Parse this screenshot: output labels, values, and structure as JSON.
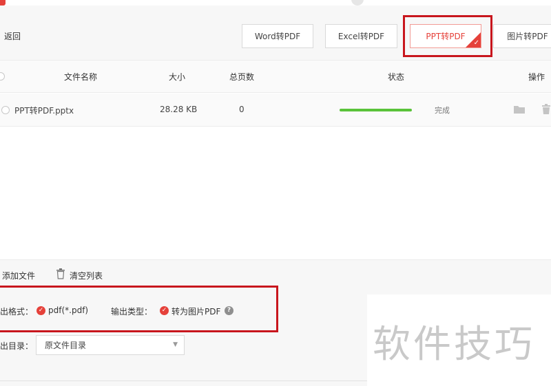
{
  "toolbar": {
    "back_label": "返回",
    "tabs": [
      {
        "label": "Word转PDF"
      },
      {
        "label": "Excel转PDF"
      },
      {
        "label": "PPT转PDF",
        "selected": true
      },
      {
        "label": "图片转PDF"
      }
    ]
  },
  "table": {
    "headers": {
      "filename": "文件名称",
      "size": "大小",
      "pages": "总页数",
      "status": "状态",
      "actions": "操作"
    },
    "rows": [
      {
        "filename": "PPT转PDF.pptx",
        "size": "28.28 KB",
        "pages": "0",
        "progress": 1.0,
        "status": "完成"
      }
    ]
  },
  "bottom": {
    "add_file_label": "添加文件",
    "clear_list_label": "清空列表",
    "output_format_label": "出格式：",
    "output_format_value": "pdf(*.pdf)",
    "output_type_label": "输出类型：",
    "output_type_value": "转为图片PDF",
    "output_dir_label": "出目录：",
    "output_dir_value": "原文件目录"
  },
  "watermark": "软件技巧",
  "colors": {
    "accent": "#e5413a",
    "annotation": "#c8161d",
    "progress": "#5ac33a"
  }
}
